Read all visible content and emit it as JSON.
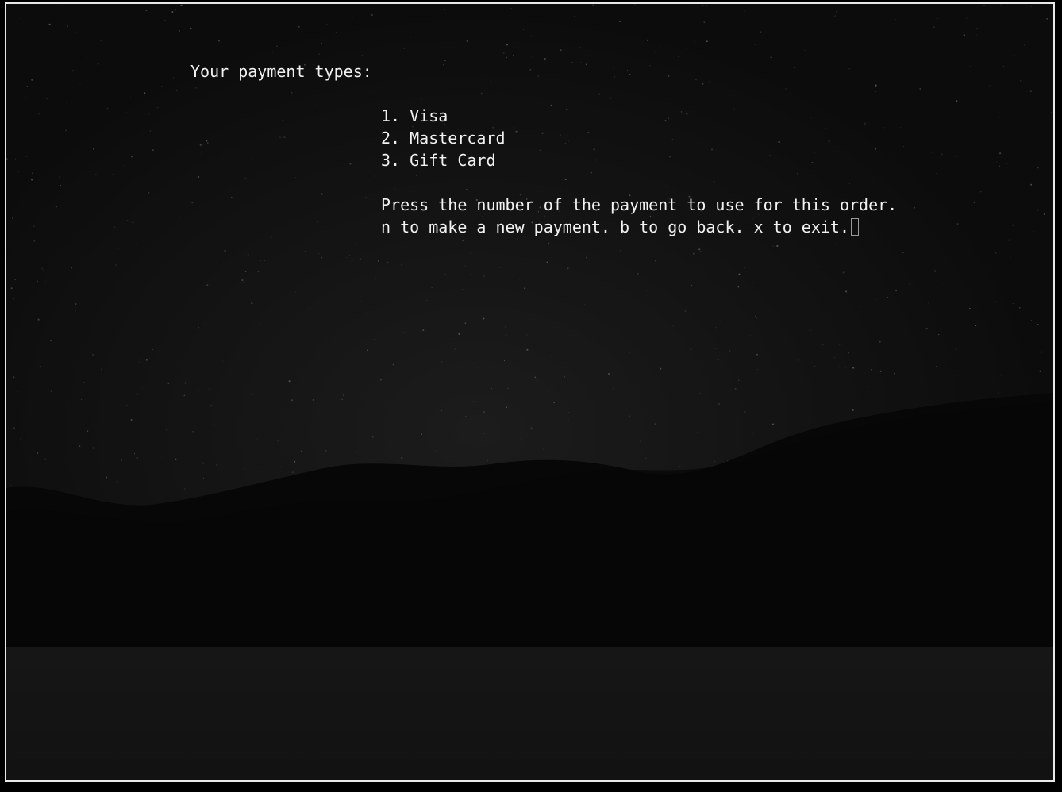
{
  "prompt": {
    "heading": "Your payment types:",
    "options": [
      {
        "label": "1. Visa"
      },
      {
        "label": "2. Mastercard"
      },
      {
        "label": "3. Gift Card"
      }
    ],
    "instruction": "Press the number of the payment to use for this order.",
    "commands": "n to make a new payment. b to go back. x to exit."
  },
  "colors": {
    "text": "#f2f2f2",
    "border": "#e8e8e8",
    "background": "#0b0b0b"
  }
}
